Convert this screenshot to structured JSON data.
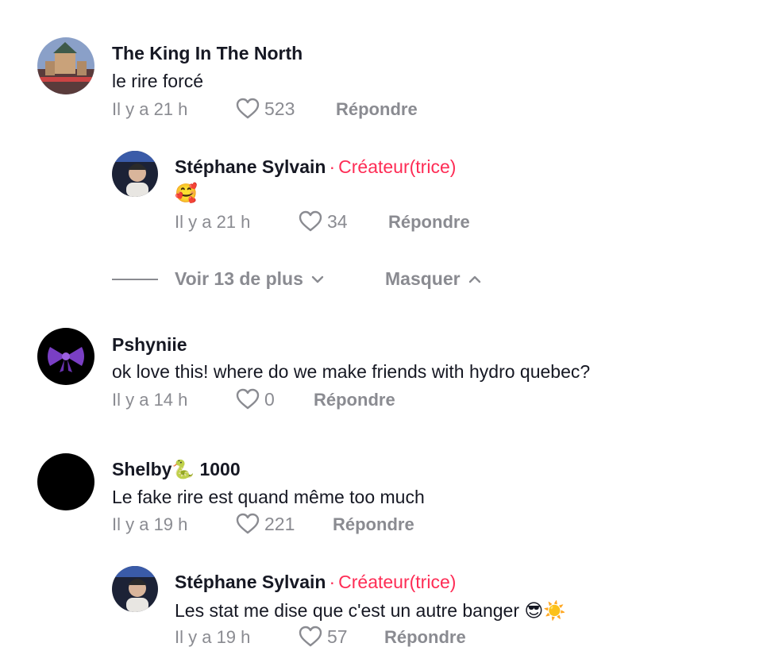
{
  "comments": [
    {
      "username": "The King In The North",
      "text": "le rire forcé",
      "time": "Il y a 21 h",
      "likes": "523",
      "reply": "Répondre"
    },
    {
      "username": "Stéphane Sylvain",
      "creator": "Créateur(trice)",
      "text": "🥰",
      "time": "Il y a 21 h",
      "likes": "34",
      "reply": "Répondre"
    },
    {
      "username": "Pshyniie",
      "text": "ok love this! where do we make friends with hydro quebec?",
      "time": "Il y a 14 h",
      "likes": "0",
      "reply": "Répondre"
    },
    {
      "username": "Shelby🐍 1000",
      "text": "Le fake rire est quand même too much",
      "time": "Il y a 19 h",
      "likes": "221",
      "reply": "Répondre"
    },
    {
      "username": "Stéphane Sylvain",
      "creator": "Créateur(trice)",
      "text": "Les stat me dise que c'est un autre banger 😎☀️",
      "time": "Il y a 19 h",
      "likes": "57",
      "reply": "Répondre"
    }
  ],
  "thread": {
    "view_more": "Voir 13 de plus",
    "hide": "Masquer"
  },
  "colors": {
    "creator": "#fe2c55",
    "meta": "#8a8b91",
    "text": "#161823"
  }
}
